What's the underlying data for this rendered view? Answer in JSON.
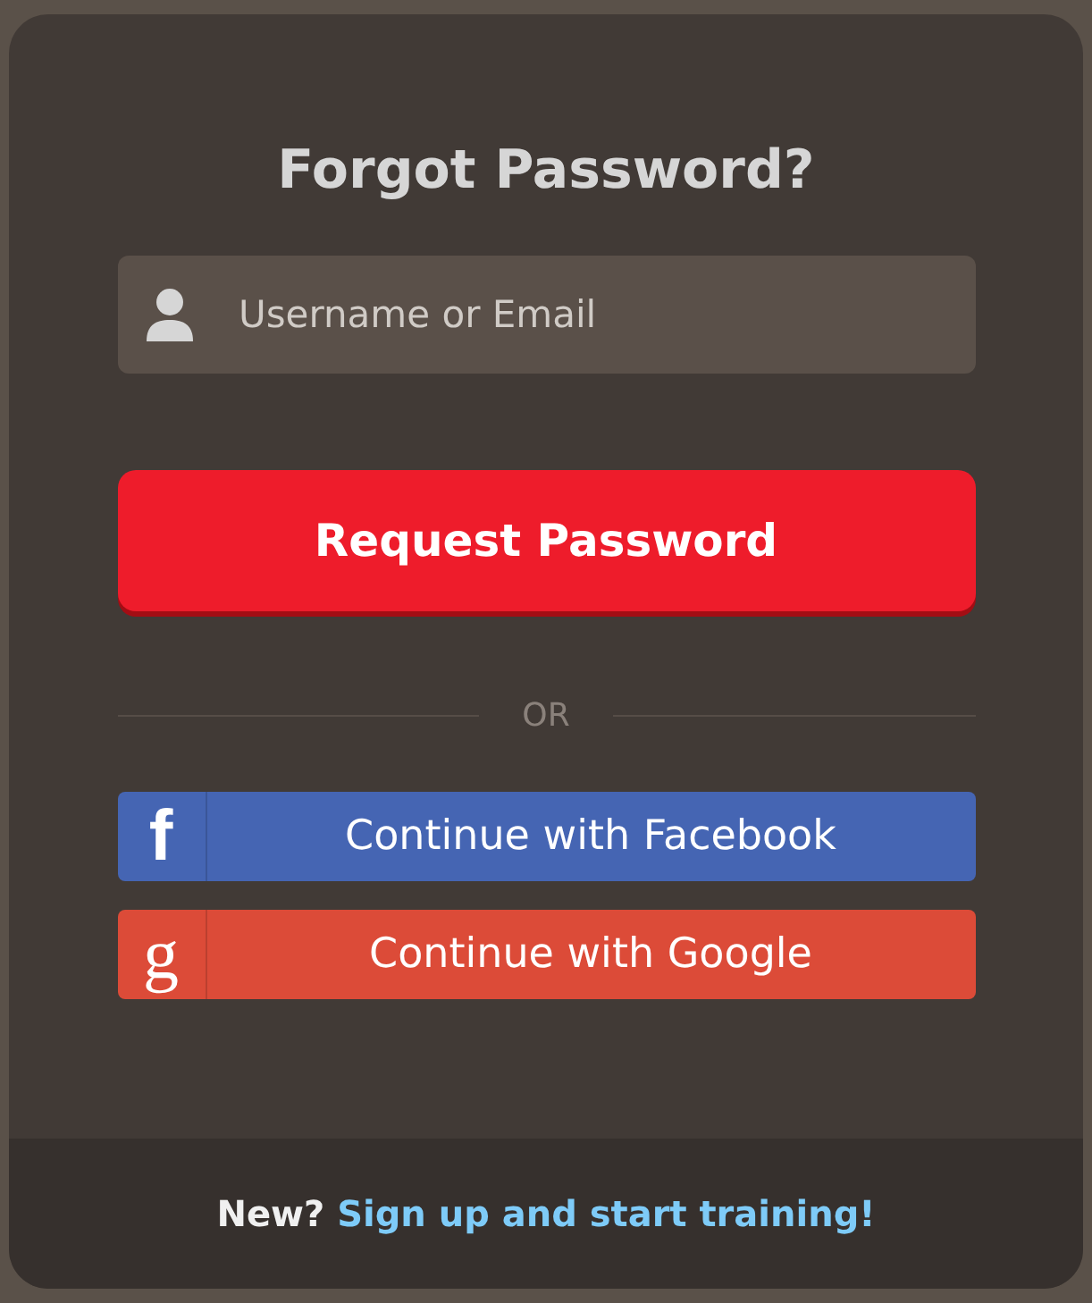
{
  "title": "Forgot Password?",
  "username_field": {
    "placeholder": "Username or Email"
  },
  "submit_button": {
    "label": "Request Password"
  },
  "divider": {
    "label": "OR"
  },
  "social_buttons": [
    {
      "kind": "facebook",
      "glyph": "f",
      "label": "Continue with Facebook",
      "color": "#4565b3"
    },
    {
      "kind": "google",
      "glyph": "g",
      "label": "Continue with Google",
      "color": "#dc4b38"
    }
  ],
  "footer": {
    "prompt": "New?",
    "link": "Sign up and start training!"
  }
}
